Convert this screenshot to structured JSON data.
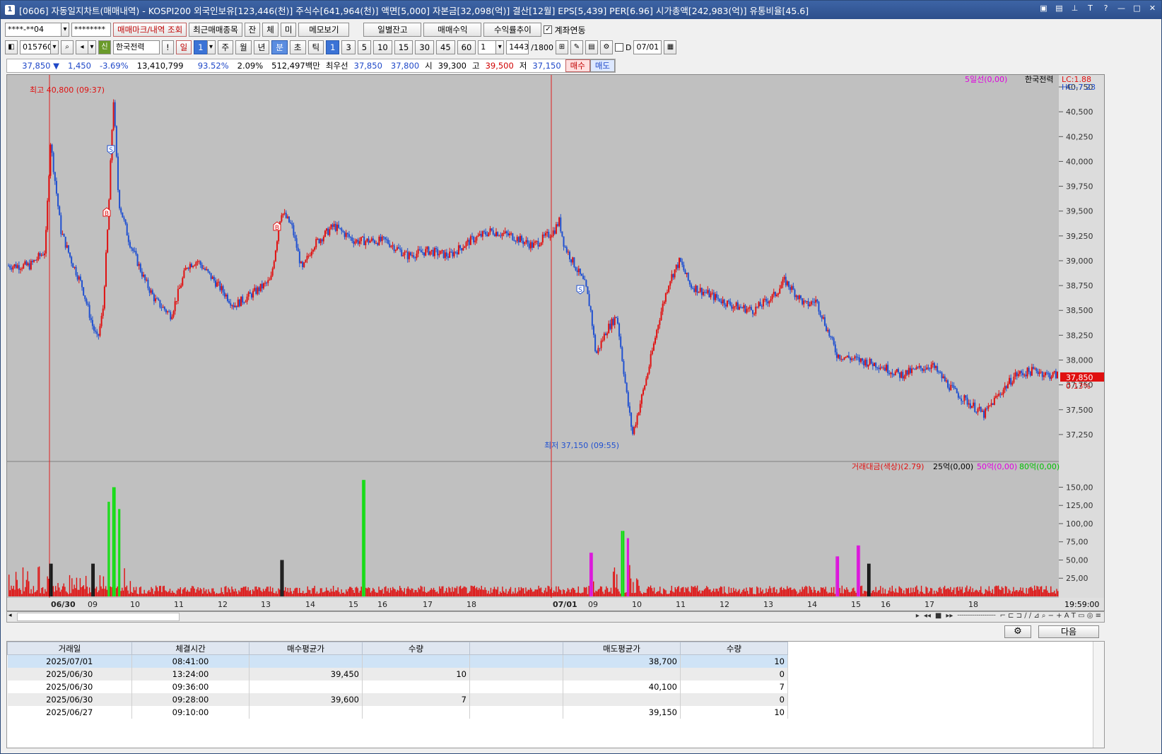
{
  "window": {
    "title": "[0606] 자동일지차트(매매내역) - KOSPI200 외국인보유[123,446(천)] 주식수[641,964(천)] 액면[5,000] 자본금[32,098(억)] 결산[12월] EPS[5,439] PER[6.96] 시가총액[242,983(억)] 유통비율[45.6]",
    "icon_label": "1"
  },
  "toolbar1": {
    "account": "****-**04",
    "password": "********",
    "btn_mark": "매매마크/내역 조회",
    "btn_recent": "최근매매종목",
    "btn_jan": "잔",
    "btn_che": "체",
    "btn_mi": "미",
    "btn_memo": "메모보기",
    "btn_daily": "일별잔고",
    "btn_profit": "매매수익",
    "btn_rate": "수익률추이",
    "link_label": "계좌연동"
  },
  "toolbar2": {
    "code": "015760",
    "badge": "신",
    "stock_name": "한국전력",
    "btn_excl": "!",
    "btn_day": "일",
    "day_value": "1",
    "btn_week": "주",
    "btn_month": "월",
    "btn_year": "년",
    "btn_min": "분",
    "btn_sec": "초",
    "btn_tick": "틱",
    "intervals": [
      "1",
      "3",
      "5",
      "10",
      "15",
      "30",
      "45",
      "60"
    ],
    "count_sel": "1",
    "bar_count": "1443",
    "bar_total": "/1800",
    "date_check": "D",
    "date": "07/01"
  },
  "quote": {
    "price": "37,850",
    "change": "1,450",
    "change_pct": "-3.69%",
    "volume": "13,410,799",
    "vol_ratio": "93.52%",
    "turnover": "2.09%",
    "amount": "512,497백만",
    "best_label": "최우선",
    "ask": "37,850",
    "bid": "37,800",
    "open_label": "시",
    "open": "39,300",
    "high_label": "고",
    "high": "39,500",
    "low_label": "저",
    "low": "37,150",
    "buy_btn": "매수",
    "sell_btn": "매도"
  },
  "chart": {
    "legend_ma": "5일선(0,00)",
    "legend_stock": "한국전력",
    "lc": "LC:1.88",
    "hc": "HC:-7.23",
    "high_note": "최고 40,800 (09:37)",
    "low_note": "최저 37,150 (09:55)",
    "current_price": "37,850",
    "current_pct": "0.13%",
    "vol_legend_title": "거래대금(색상)(2.79)",
    "vol_legend_25": "25억(0,00)",
    "vol_legend_50": "50억(0,00)",
    "vol_legend_80": "80억(0,00)",
    "last_time": "19:59:00",
    "colors": {
      "up": "#e01010",
      "down": "#2050d0",
      "bg": "#c0c0c0",
      "vol_green": "#00e000",
      "vol_magenta": "#e000e0"
    }
  },
  "chart_data": {
    "type": "candlestick",
    "y_ticks": [
      "40,750",
      "40,500",
      "40,250",
      "40,000",
      "39,750",
      "39,500",
      "39,250",
      "39,000",
      "38,750",
      "38,500",
      "38,250",
      "38,000",
      "37,750",
      "37,500",
      "37,250"
    ],
    "vol_ticks": [
      "150,00",
      "125,00",
      "100,00",
      "75,00",
      "50,00",
      "25,00"
    ],
    "x_labels": [
      "06/30",
      "09",
      "10",
      "11",
      "12",
      "13",
      "14",
      "15",
      "16",
      "17",
      "18",
      "07/01",
      "09",
      "10",
      "11",
      "12",
      "13",
      "14",
      "15",
      "16",
      "17",
      "18"
    ],
    "ylim": [
      37100,
      40800
    ],
    "price_path": [
      [
        0,
        38950
      ],
      [
        0.02,
        38950
      ],
      [
        0.035,
        39100
      ],
      [
        0.04,
        40200
      ],
      [
        0.05,
        39300
      ],
      [
        0.06,
        39000
      ],
      [
        0.07,
        38750
      ],
      [
        0.08,
        38350
      ],
      [
        0.085,
        38200
      ],
      [
        0.09,
        38500
      ],
      [
        0.095,
        39400
      ],
      [
        0.1,
        40650
      ],
      [
        0.105,
        39600
      ],
      [
        0.115,
        39200
      ],
      [
        0.13,
        38800
      ],
      [
        0.14,
        38600
      ],
      [
        0.155,
        38450
      ],
      [
        0.17,
        38950
      ],
      [
        0.18,
        39000
      ],
      [
        0.2,
        38750
      ],
      [
        0.215,
        38550
      ],
      [
        0.23,
        38650
      ],
      [
        0.25,
        38800
      ],
      [
        0.26,
        39500
      ],
      [
        0.27,
        39350
      ],
      [
        0.28,
        38900
      ],
      [
        0.29,
        39150
      ],
      [
        0.31,
        39350
      ],
      [
        0.33,
        39200
      ],
      [
        0.36,
        39200
      ],
      [
        0.38,
        39050
      ],
      [
        0.4,
        39100
      ],
      [
        0.42,
        39050
      ],
      [
        0.44,
        39200
      ],
      [
        0.46,
        39300
      ],
      [
        0.48,
        39250
      ],
      [
        0.5,
        39150
      ],
      [
        0.52,
        39300
      ],
      [
        0.525,
        39400
      ],
      [
        0.53,
        39150
      ],
      [
        0.54,
        38950
      ],
      [
        0.55,
        38750
      ],
      [
        0.555,
        38500
      ],
      [
        0.56,
        38050
      ],
      [
        0.57,
        38300
      ],
      [
        0.58,
        38450
      ],
      [
        0.59,
        37600
      ],
      [
        0.595,
        37250
      ],
      [
        0.61,
        37900
      ],
      [
        0.62,
        38400
      ],
      [
        0.63,
        38800
      ],
      [
        0.64,
        39000
      ],
      [
        0.65,
        38750
      ],
      [
        0.67,
        38650
      ],
      [
        0.69,
        38550
      ],
      [
        0.71,
        38500
      ],
      [
        0.73,
        38650
      ],
      [
        0.74,
        38800
      ],
      [
        0.76,
        38550
      ],
      [
        0.77,
        38600
      ],
      [
        0.79,
        38050
      ],
      [
        0.81,
        38000
      ],
      [
        0.83,
        37950
      ],
      [
        0.85,
        37850
      ],
      [
        0.88,
        37950
      ],
      [
        0.9,
        37700
      ],
      [
        0.93,
        37450
      ],
      [
        0.94,
        37600
      ],
      [
        0.96,
        37850
      ],
      [
        0.98,
        37900
      ],
      [
        0.99,
        37850
      ],
      [
        1,
        37850
      ]
    ]
  },
  "footer": {
    "next_btn": "다음"
  },
  "trade_table": {
    "headers": [
      "거래일",
      "체결시간",
      "매수평균가",
      "수량",
      "",
      "매도평균가",
      "수량"
    ],
    "rows": [
      [
        "2025/07/01",
        "08:41:00",
        "",
        "",
        "",
        "38,700",
        "10"
      ],
      [
        "2025/06/30",
        "13:24:00",
        "39,450",
        "10",
        "",
        "",
        "0"
      ],
      [
        "2025/06/30",
        "09:36:00",
        "",
        "",
        "",
        "40,100",
        "7"
      ],
      [
        "2025/06/30",
        "09:28:00",
        "39,600",
        "7",
        "",
        "",
        "0"
      ],
      [
        "2025/06/27",
        "09:10:00",
        "",
        "",
        "",
        "39,150",
        "10"
      ]
    ]
  }
}
